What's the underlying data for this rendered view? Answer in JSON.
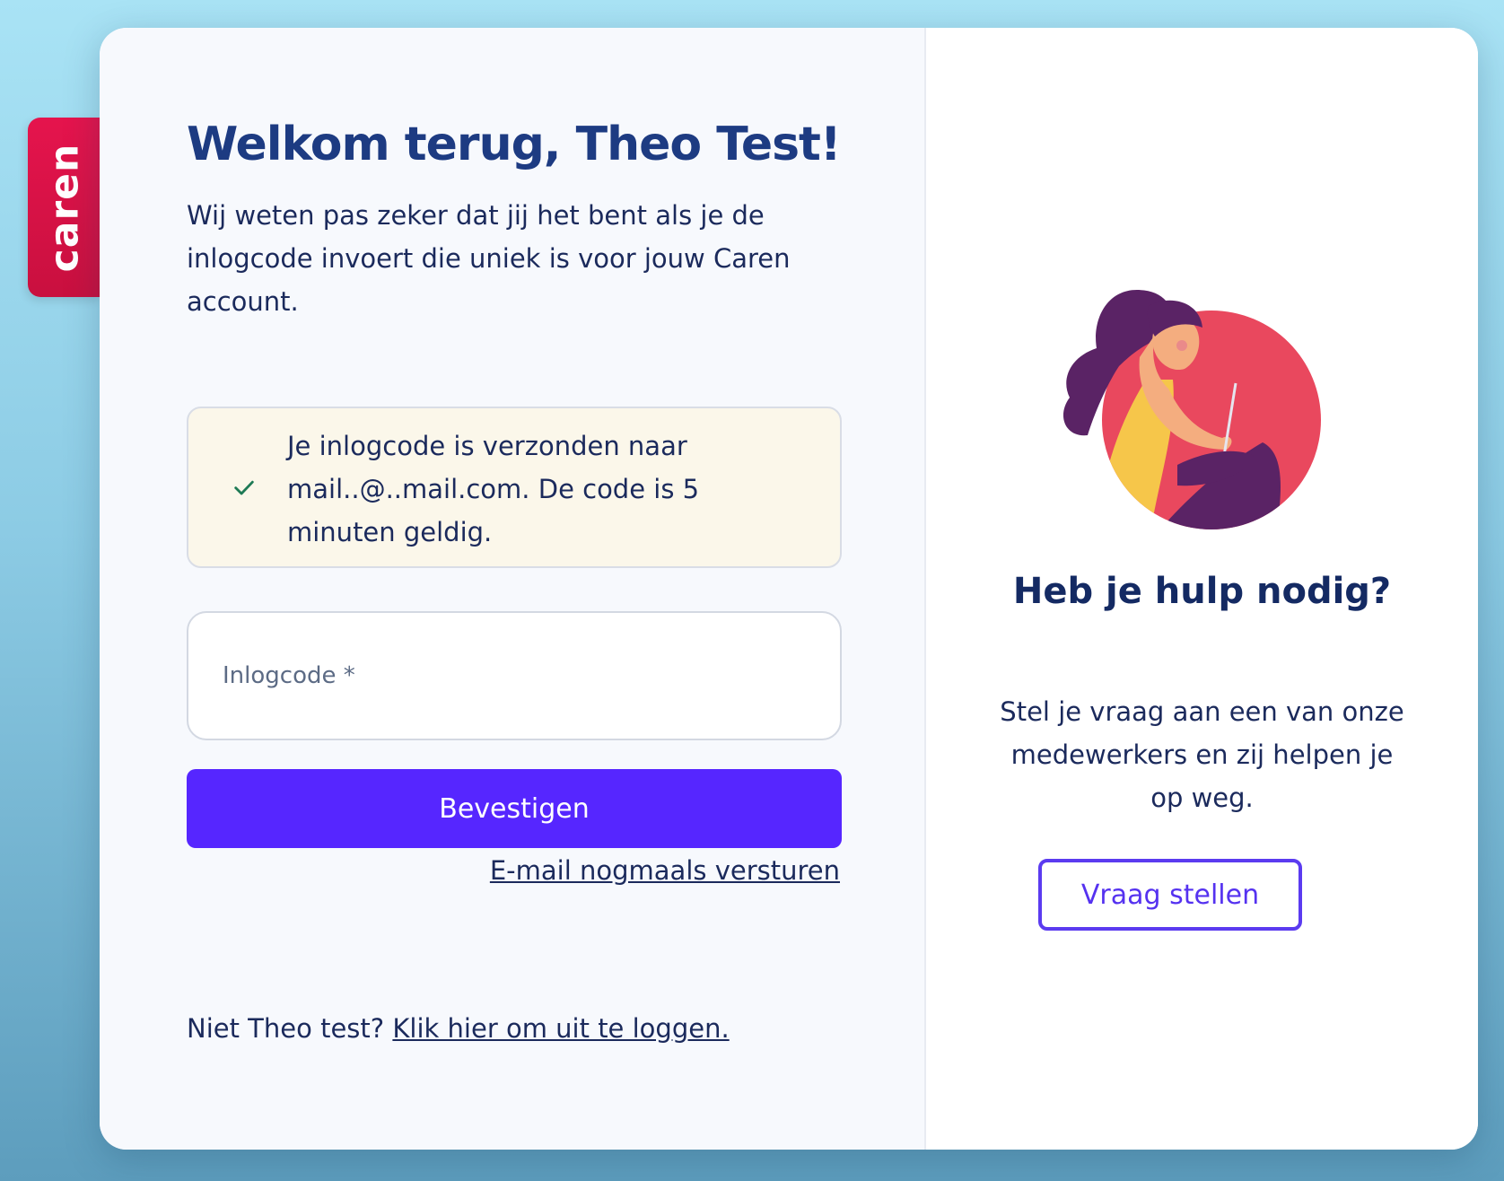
{
  "brand": {
    "logo_text": "caren",
    "accent_color": "#e5144d"
  },
  "login": {
    "title": "Welkom terug, Theo Test!",
    "intro": "Wij weten pas zeker dat jij het bent als je de inlogcode invoert die uniek is voor jouw Caren account.",
    "notice": {
      "icon": "check-icon",
      "text": "Je inlogcode is verzonden naar mail..@..mail.com. De code is 5 minuten geldig."
    },
    "code_input": {
      "placeholder": "Inlogcode *",
      "value": ""
    },
    "confirm_button": "Bevestigen",
    "resend_link": "E-mail nogmaals versturen",
    "logout": {
      "prefix": "Niet Theo test?",
      "link": "Klik hier om uit te loggen."
    },
    "primary_color": "#5626ff"
  },
  "help": {
    "title": "Heb je hulp nodig?",
    "text": "Stel je vraag aan een van onze medewerkers en zij helpen je op weg.",
    "button": "Vraag stellen",
    "illustration": "woman-with-laptop-illustration"
  }
}
